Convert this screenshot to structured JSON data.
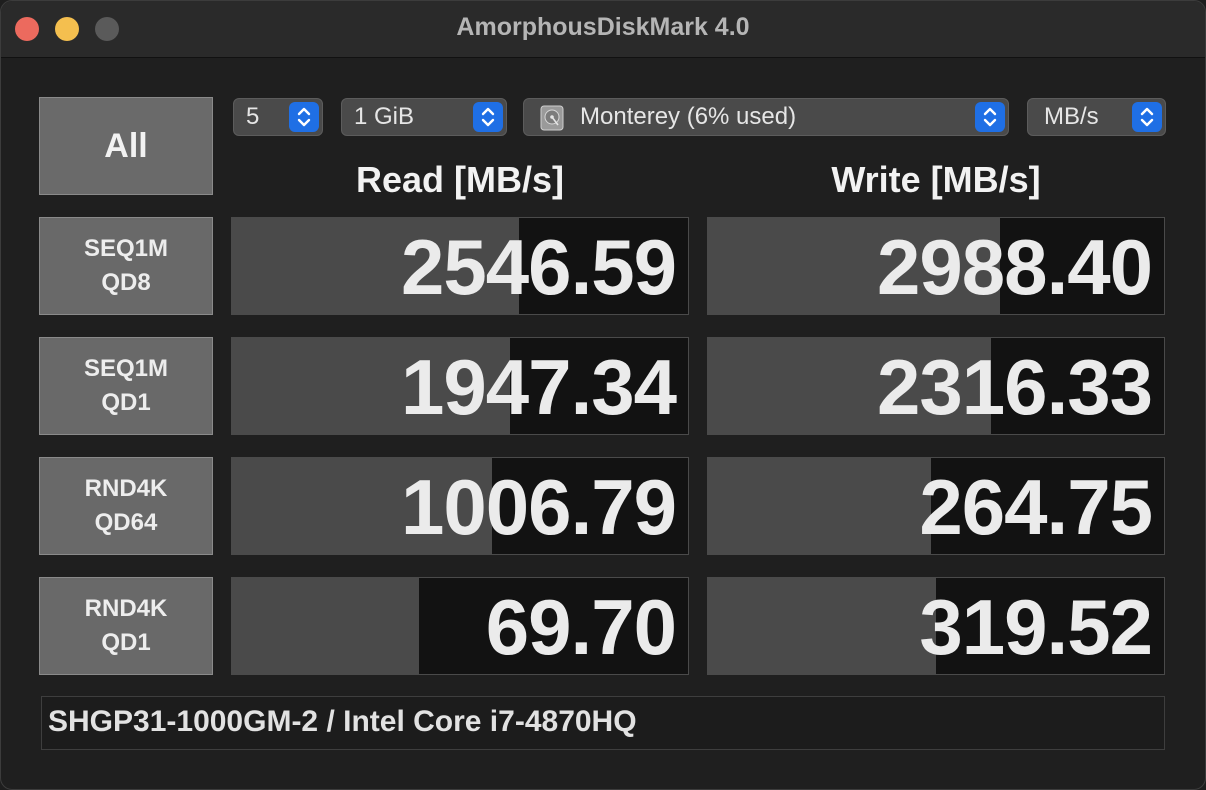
{
  "window": {
    "title": "AmorphousDiskMark 4.0"
  },
  "controls": {
    "all_label": "All",
    "count": "5",
    "size": "1 GiB",
    "drive": "Monterey (6% used)",
    "unit": "MB/s"
  },
  "headers": {
    "read": "Read [MB/s]",
    "write": "Write [MB/s]"
  },
  "tests": [
    {
      "line1": "SEQ1M",
      "line2": "QD8",
      "read": "2546.59",
      "write": "2988.40",
      "read_bar_fraction": 0.63,
      "write_bar_fraction": 0.64
    },
    {
      "line1": "SEQ1M",
      "line2": "QD1",
      "read": "1947.34",
      "write": "2316.33",
      "read_bar_fraction": 0.61,
      "write_bar_fraction": 0.62
    },
    {
      "line1": "RND4K",
      "line2": "QD64",
      "read": "1006.79",
      "write": "264.75",
      "read_bar_fraction": 0.57,
      "write_bar_fraction": 0.49
    },
    {
      "line1": "RND4K",
      "line2": "QD1",
      "read": "69.70",
      "write": "319.52",
      "read_bar_fraction": 0.41,
      "write_bar_fraction": 0.5
    }
  ],
  "footer": {
    "info": "SHGP31-1000GM-2 / Intel Core i7-4870HQ"
  },
  "colors": {
    "accent": "#1f6fe5",
    "bar_fill": "#4a4a4a",
    "cell_bg": "#121212"
  },
  "icons": {
    "stepper": "up-down-chevron-icon",
    "drive": "hard-disk-icon"
  }
}
